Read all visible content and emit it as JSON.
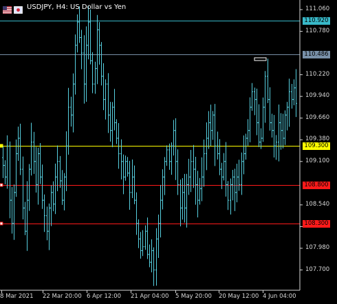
{
  "title": {
    "symbol_text": "USDJPY, H4:  US Dollar vs Yen"
  },
  "colors": {
    "background": "#000000",
    "bar": "#57d0e0",
    "axis_text": "#d8d8d8",
    "line_cyan": "#38b8c8",
    "line_gray": "#7890a8",
    "line_yellow": "#ffff00",
    "line_red": "#ff1a1a"
  },
  "price_axis": {
    "labels": [
      "111.060",
      "110.780",
      "110.220",
      "109.940",
      "109.660",
      "109.380",
      "109.100",
      "108.540",
      "108.260",
      "107.980",
      "107.700"
    ]
  },
  "time_axis": {
    "labels": [
      "8 Mar 2021",
      "22 Mar 20:00",
      "6 Apr 12:00",
      "21 Apr 04:00",
      "5 May 20:00",
      "20 May 12:00",
      "4 Jun 04:00"
    ]
  },
  "price_lines": [
    {
      "name": "cyan-line",
      "price": 110.92,
      "tag": "110.920",
      "color": "#38b8c8",
      "tag_bg": "#38b8c8",
      "tag_fg": "#000000",
      "marker": false
    },
    {
      "name": "gray-line",
      "price": 110.486,
      "tag": "110.486",
      "color": "#7890a8",
      "tag_bg": "#7890a8",
      "tag_fg": "#000000",
      "marker": false
    },
    {
      "name": "yellow-line",
      "price": 109.3,
      "tag": "109.300",
      "color": "#ffff00",
      "tag_bg": "#ffff00",
      "tag_fg": "#000000",
      "marker": true
    },
    {
      "name": "red-line-upper",
      "price": 108.8,
      "tag": "108.800",
      "color": "#ff1a1a",
      "tag_bg": "#ff1a1a",
      "tag_fg": "#000000",
      "marker": true
    },
    {
      "name": "red-line-lower",
      "price": 108.3,
      "tag": "108.300",
      "color": "#ff1a1a",
      "tag_bg": "#ff1a1a",
      "tag_fg": "#000000",
      "marker": true
    }
  ],
  "chart_data": {
    "type": "ohlc",
    "symbol": "USDJPY",
    "timeframe": "H4",
    "ylim": [
      107.58,
      111.1
    ],
    "closes": [
      109.05,
      108.9,
      109.3,
      108.6,
      108.3,
      108.7,
      109.2,
      109.4,
      109.0,
      108.5,
      108.2,
      108.6,
      109.0,
      109.35,
      109.1,
      108.8,
      109.2,
      108.9,
      108.6,
      108.4,
      108.2,
      108.5,
      108.7,
      108.55,
      108.9,
      109.1,
      108.85,
      108.6,
      108.9,
      109.3,
      109.8,
      109.7,
      110.1,
      110.6,
      110.9,
      110.7,
      110.5,
      110.1,
      110.6,
      110.9,
      110.4,
      110.1,
      110.3,
      110.8,
      110.6,
      110.2,
      109.9,
      110.1,
      109.7,
      109.5,
      109.8,
      109.6,
      109.4,
      109.2,
      109.1,
      108.9,
      109.1,
      108.95,
      108.7,
      108.9,
      108.6,
      108.3,
      108.1,
      107.95,
      108.0,
      108.2,
      107.9,
      107.8,
      107.95,
      107.7,
      108.1,
      108.3,
      108.6,
      108.9,
      109.1,
      109.25,
      109.1,
      109.3,
      109.5,
      109.1,
      108.8,
      108.5,
      108.7,
      108.5,
      108.8,
      108.9,
      109.1,
      109.0,
      108.8,
      108.6,
      108.75,
      108.9,
      109.2,
      109.4,
      109.6,
      109.5,
      109.7,
      109.3,
      109.2,
      109.0,
      108.9,
      109.1,
      108.8,
      108.6,
      108.8,
      108.9,
      108.7,
      108.9,
      108.8,
      109.1,
      109.2,
      109.4,
      109.5,
      109.8,
      110.0,
      109.9,
      109.6,
      109.35,
      109.4,
      109.8,
      110.2,
      109.9,
      109.6,
      109.5,
      109.3,
      109.35,
      109.6,
      109.5,
      109.4,
      109.7,
      109.8,
      110.0,
      109.9,
      110.05,
      109.85
    ]
  }
}
